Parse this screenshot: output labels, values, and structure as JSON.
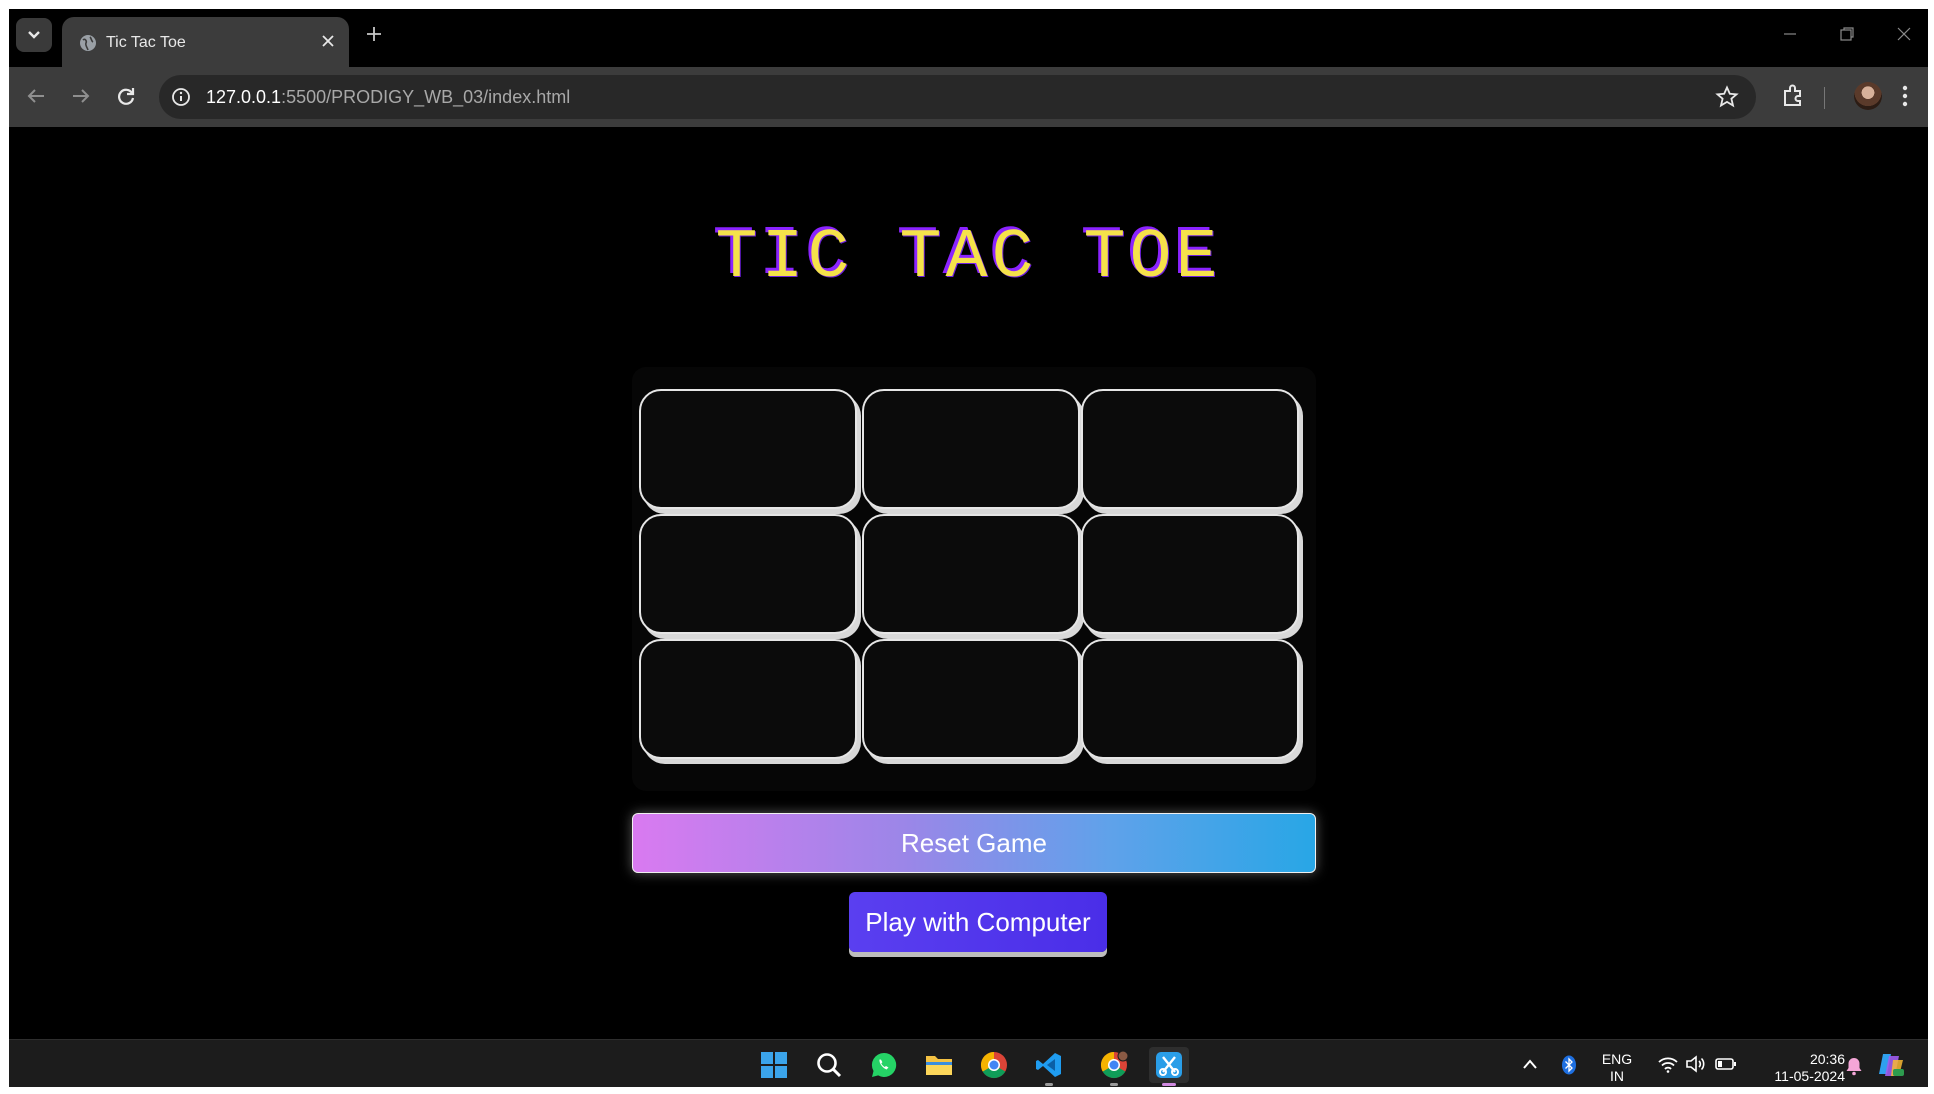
{
  "browser": {
    "tab_title": "Tic Tac Toe",
    "url_host": "127.0.0.1",
    "url_path": ":5500/PRODIGY_WB_03/index.html"
  },
  "game": {
    "title": "TIC TAC TOE",
    "cells": [
      "",
      "",
      "",
      "",
      "",
      "",
      "",
      "",
      ""
    ],
    "reset_label": "Reset Game",
    "computer_label": "Play with Computer"
  },
  "taskbar": {
    "apps": [
      "start-icon",
      "search-icon",
      "whatsapp-icon",
      "file-explorer-icon",
      "chrome-icon",
      "vscode-icon",
      "chrome-profile-icon",
      "snipping-tool-icon"
    ],
    "lang_line1": "ENG",
    "lang_line2": "IN",
    "time": "20:36",
    "date": "11-05-2024"
  },
  "colors": {
    "title_fill": "#f5e24a",
    "title_shadow": "#8b23ff",
    "reset_gradient_start": "#d97af0",
    "reset_gradient_end": "#28a6e6",
    "computer_button": "#4a2ee8"
  }
}
